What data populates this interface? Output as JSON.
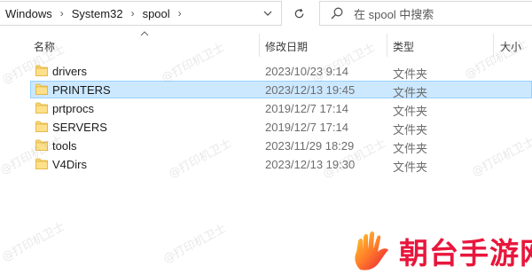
{
  "address_bar": {
    "crumbs": [
      "Windows",
      "System32",
      "spool"
    ],
    "separator": "›"
  },
  "search": {
    "placeholder": "在 spool 中搜索"
  },
  "columns": {
    "name": "名称",
    "date": "修改日期",
    "type": "类型",
    "size": "大小"
  },
  "files": [
    {
      "name": "drivers",
      "date": "2023/10/23 9:14",
      "type": "文件夹",
      "selected": false
    },
    {
      "name": "PRINTERS",
      "date": "2023/12/13 19:45",
      "type": "文件夹",
      "selected": true
    },
    {
      "name": "prtprocs",
      "date": "2019/12/7 17:14",
      "type": "文件夹",
      "selected": false
    },
    {
      "name": "SERVERS",
      "date": "2019/12/7 17:14",
      "type": "文件夹",
      "selected": false
    },
    {
      "name": "tools",
      "date": "2023/11/29 18:29",
      "type": "文件夹",
      "selected": false
    },
    {
      "name": "V4Dirs",
      "date": "2023/12/13 19:30",
      "type": "文件夹",
      "selected": false
    }
  ],
  "watermark_text": "@打印机卫士",
  "logo": {
    "text": "朝台手游网",
    "color": "#e8163c"
  },
  "colors": {
    "selection_fill": "#cce8ff",
    "selection_border": "#99d1ff",
    "folder_yellow": "#f8d775"
  }
}
